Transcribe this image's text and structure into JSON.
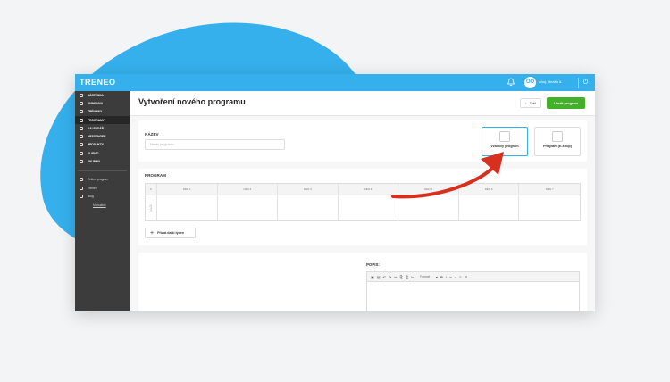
{
  "app": {
    "logo": "TRENEO",
    "user_name": "Ahoj, Health &",
    "avatar_text": "OO",
    "accent": "#35b0ec",
    "green": "#43b02a"
  },
  "sidebar": {
    "items": [
      {
        "label": "NÁSTĚNKA",
        "active": false
      },
      {
        "label": "KNIHOVNA",
        "active": false
      },
      {
        "label": "TRÉNINKY",
        "active": false
      },
      {
        "label": "PROGRAMY",
        "active": true
      },
      {
        "label": "KALENDÁŘ",
        "active": false
      },
      {
        "label": "MESSENGER",
        "active": false
      },
      {
        "label": "PRODUKTY",
        "active": false
      },
      {
        "label": "KLIENTI",
        "active": false
      },
      {
        "label": "SKUPINY",
        "active": false
      }
    ],
    "secondary": [
      {
        "label": "Online program"
      },
      {
        "label": "Treneři"
      },
      {
        "label": "Blog"
      }
    ],
    "manual": "Manuálek"
  },
  "page": {
    "title": "Vytvoření nového programu",
    "back_label": "Zpět",
    "save_label": "Uložit program",
    "name_label": "NÁZEV",
    "name_placeholder": "Název programu",
    "type_sample": "Vzorový program",
    "type_eshop": "Program (E-shop)",
    "program_label": "PROGRAM",
    "grid_headers": [
      "#",
      "DEN 1",
      "DEN 2",
      "DEN 3",
      "DEN 4",
      "DEN 5",
      "DEN 6",
      "DEN 7"
    ],
    "week_number": "1",
    "add_week": "Přidat další týden",
    "popis_label": "POPIS:",
    "editor_format": "Format"
  }
}
